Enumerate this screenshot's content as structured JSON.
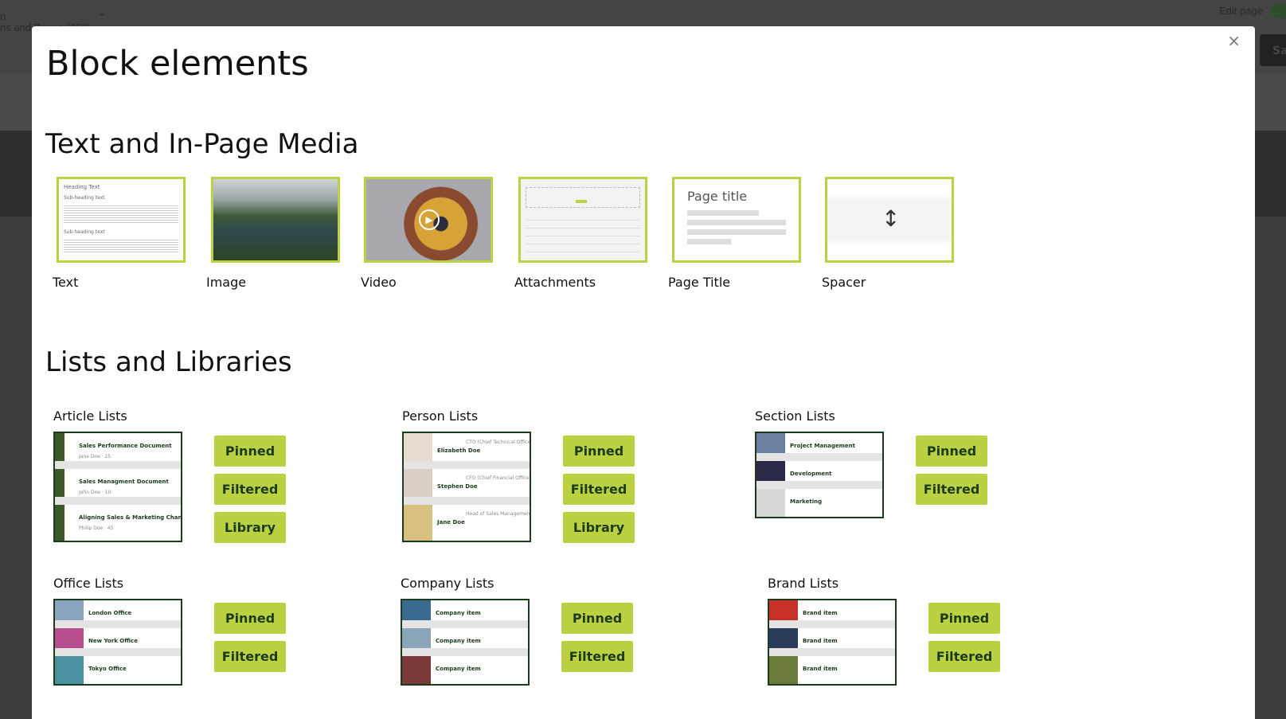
{
  "background": {
    "breadcrumb_top": "n",
    "breadcrumb": "ns and Pages (458)",
    "edit_page_label": "Edit page",
    "save_label": "Sa"
  },
  "modal": {
    "title": "Block elements",
    "close_icon": "×"
  },
  "sections": {
    "text_media": {
      "title": "Text and In-Page Media",
      "items": [
        {
          "label": "Text",
          "thumb_heading": "Heading Text",
          "thumb_sub": "Sub-heading text"
        },
        {
          "label": "Image"
        },
        {
          "label": "Video"
        },
        {
          "label": "Attachments"
        },
        {
          "label": "Page Title",
          "thumb_text": "Page title"
        },
        {
          "label": "Spacer"
        }
      ]
    },
    "lists": {
      "title": "Lists and Libraries",
      "groups": [
        {
          "label": "Article Lists",
          "rows": [
            "Sales Performance Document",
            "Sales Managment Document",
            "Aligning Sales & Marketing Channels"
          ],
          "meta": [
            "Jane Doe · 25",
            "John Doe · 10",
            "Philip Doe · 45"
          ],
          "buttons": [
            "Pinned",
            "Filtered",
            "Library"
          ]
        },
        {
          "label": "Person Lists",
          "rows": [
            "Elizabeth Doe",
            "Stephen Doe",
            "Jane Doe"
          ],
          "meta": [
            "CTO (Chief Technical Officer)",
            "CFO (Chief Financial Officer)",
            "Head of Sales Management"
          ],
          "buttons": [
            "Pinned",
            "Filtered",
            "Library"
          ]
        },
        {
          "label": "Section Lists",
          "rows": [
            "Project Management",
            "Development",
            "Marketing"
          ],
          "buttons": [
            "Pinned",
            "Filtered"
          ]
        },
        {
          "label": "Office Lists",
          "rows": [
            "London Office",
            "New York Office",
            "Tokyo Office"
          ],
          "buttons": [
            "Pinned",
            "Filtered"
          ]
        },
        {
          "label": "Company Lists",
          "rows": [
            "Company item",
            "Company item",
            "Company item"
          ],
          "buttons": [
            "Pinned",
            "Filtered"
          ]
        },
        {
          "label": "Brand Lists",
          "rows": [
            "Brand item",
            "Brand item",
            "Brand item"
          ],
          "buttons": [
            "Pinned",
            "Filtered"
          ]
        }
      ]
    }
  },
  "colors": {
    "accent": "#bcd142",
    "dark_green": "#1c3a1c"
  }
}
